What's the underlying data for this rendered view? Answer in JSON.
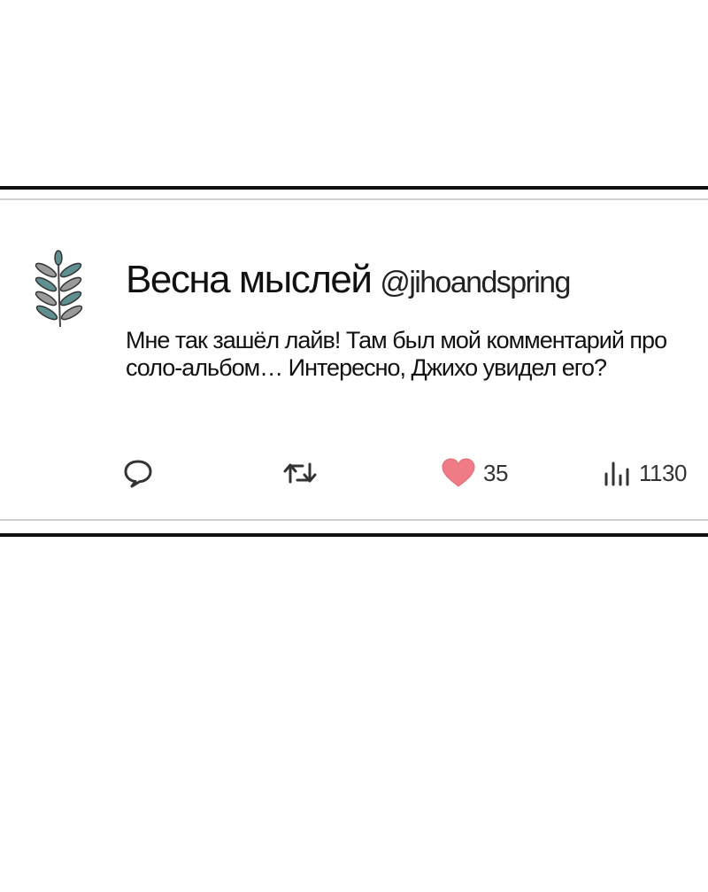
{
  "post": {
    "display_name": "Весна мыслей",
    "handle": "@jihoandspring",
    "text": "Мне так зашёл лайв! Там был мой комментарий про соло-альбом… Интересно, Джихо увидел его?",
    "avatar_icon": "leaf-branch-icon",
    "leaf_colors": [
      "#5f8f91",
      "#9a9a9a"
    ]
  },
  "actions": {
    "reply_icon": "speech-bubble-icon",
    "repost_icon": "repost-arrows-icon",
    "like_icon": "heart-icon",
    "like_color": "#ee7b86",
    "likes": "35",
    "views_icon": "bar-chart-icon",
    "views": "1130"
  }
}
